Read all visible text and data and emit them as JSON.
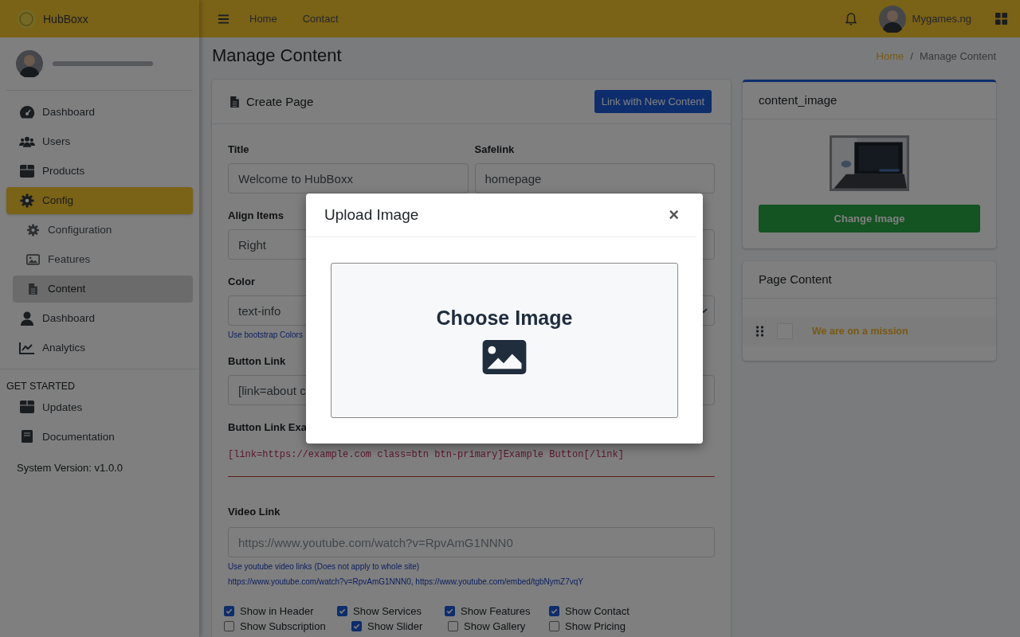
{
  "header": {
    "brand": "HubBoxx",
    "nav": [
      "Home",
      "Contact"
    ],
    "user": "Mygames.ng"
  },
  "sidebar": {
    "items": [
      {
        "label": "Dashboard",
        "selected": false
      },
      {
        "label": "Users",
        "selected": false
      },
      {
        "label": "Products",
        "selected": false
      },
      {
        "label": "Config",
        "selected": true,
        "children": [
          {
            "label": "Configuration",
            "selected": false
          },
          {
            "label": "Features",
            "selected": false
          },
          {
            "label": "Content",
            "selected": true
          }
        ]
      },
      {
        "label": "Dashboard",
        "selected": false
      },
      {
        "label": "Analytics",
        "selected": false
      }
    ],
    "section": "GET STARTED",
    "extra": [
      {
        "label": "Updates"
      },
      {
        "label": "Documentation"
      }
    ],
    "version": "System Version: v1.0.0"
  },
  "page": {
    "title": "Manage Content",
    "breadcrumb": [
      "Home",
      "/",
      "Manage Content"
    ]
  },
  "form": {
    "title": "Create Page",
    "action": "Link with New Content",
    "title_label": "Title",
    "title_value": "Welcome to HubBoxx",
    "safelink_label": "Safelink",
    "safelink_value": "homepage",
    "align_label": "Align Items",
    "align_value": "Right",
    "color_label": "Color",
    "color_value": "text-info",
    "color_hint": "Use bootstrap Colors",
    "button_link_label": "Button Link",
    "button_link_value": "[link=about c",
    "example_label": "Button Link Exa",
    "example_code": "[link=https://example.com class=btn btn-primary]Example Button[/link]",
    "video_label": "Video Link",
    "video_placeholder": "https://www.youtube.com/watch?v=RpvAmG1NNN0",
    "video_hint": "Use youtube video links (Does not apply to whole site)",
    "video_examples": "https://www.youtube.com/watch?v=RpvAmG1NNN0, https://www.youtube.com/embed/tgbNymZ7vqY",
    "checkboxes": [
      {
        "label": "Show in Header",
        "checked": true
      },
      {
        "label": "Show Services",
        "checked": true
      },
      {
        "label": "Show Features",
        "checked": true
      },
      {
        "label": "Show Contact",
        "checked": true
      },
      {
        "label": "Show Subscription",
        "checked": false
      },
      {
        "label": "Show Slider",
        "checked": true
      },
      {
        "label": "Show Gallery",
        "checked": false
      },
      {
        "label": "Show Pricing",
        "checked": false
      }
    ]
  },
  "image_card": {
    "title": "content_image",
    "button": "Change Image"
  },
  "content_card": {
    "title": "Page Content",
    "items": [
      {
        "label": "We are on a mission",
        "checked": false
      }
    ]
  },
  "modal": {
    "title": "Upload Image",
    "close": "×",
    "drop_label": "Choose Image"
  }
}
